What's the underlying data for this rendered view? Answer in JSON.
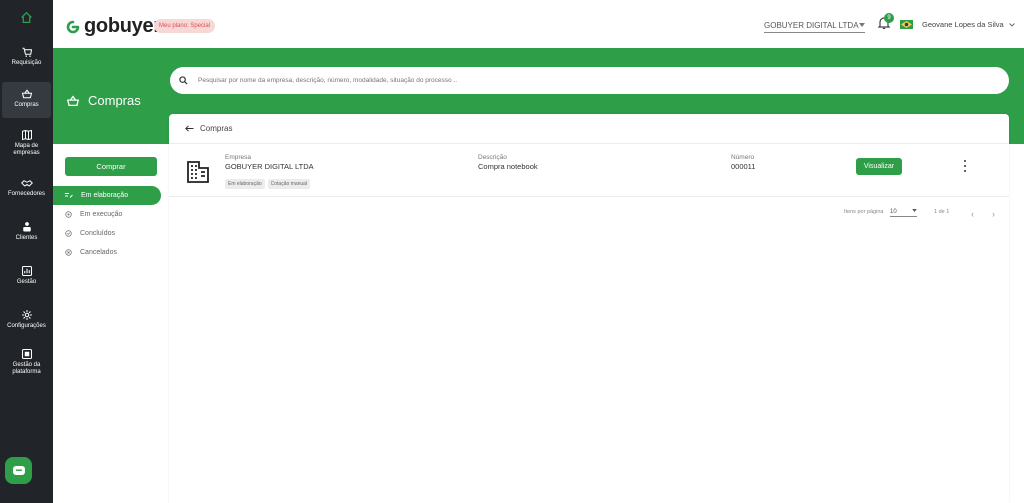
{
  "app": {
    "brand": "gobuyer",
    "brand_dot": ".",
    "plan_badge": "Meu plano: Special"
  },
  "header": {
    "company": "GOBUYER DIGITAL LTDA",
    "notifications_count": "9",
    "user_name": "Geovane Lopes da Silva"
  },
  "rail": {
    "items": [
      {
        "label": "Requisição",
        "icon": "cart-icon"
      },
      {
        "label": "Compras",
        "icon": "basket-icon"
      },
      {
        "label": "Mapa de empresas",
        "icon": "map-icon"
      },
      {
        "label": "Fornecedores",
        "icon": "handshake-icon"
      },
      {
        "label": "Clientes",
        "icon": "people-icon"
      },
      {
        "label": "Gestão",
        "icon": "chart-icon"
      },
      {
        "label": "Configurações",
        "icon": "gear-icon"
      },
      {
        "label": "Gestão da plataforma",
        "icon": "dashboard-icon"
      }
    ]
  },
  "page": {
    "title": "Compras",
    "search_placeholder": "Pesquisar por nome da empresa, descrição, número, modalidade, situação do processo ..",
    "breadcrumb": "Compras"
  },
  "sidenav": {
    "buy_button": "Comprar",
    "items": [
      {
        "label": "Em elaboração"
      },
      {
        "label": "Em execução"
      },
      {
        "label": "Concluídos"
      },
      {
        "label": "Cancelados"
      }
    ]
  },
  "purchase": {
    "company_label": "Empresa",
    "company": "GOBUYER DIGITAL LTDA",
    "description_label": "Descrição",
    "description": "Compra notebook",
    "number_label": "Número",
    "number": "000011",
    "tags": [
      "Em elaboração",
      "Cotação manual"
    ],
    "view_button": "Visualizar"
  },
  "pagination": {
    "per_page_label": "Itens por página",
    "per_page": "10",
    "range": "1 de 1"
  },
  "colors": {
    "primary": "#2e9e48",
    "rail": "#212529"
  }
}
